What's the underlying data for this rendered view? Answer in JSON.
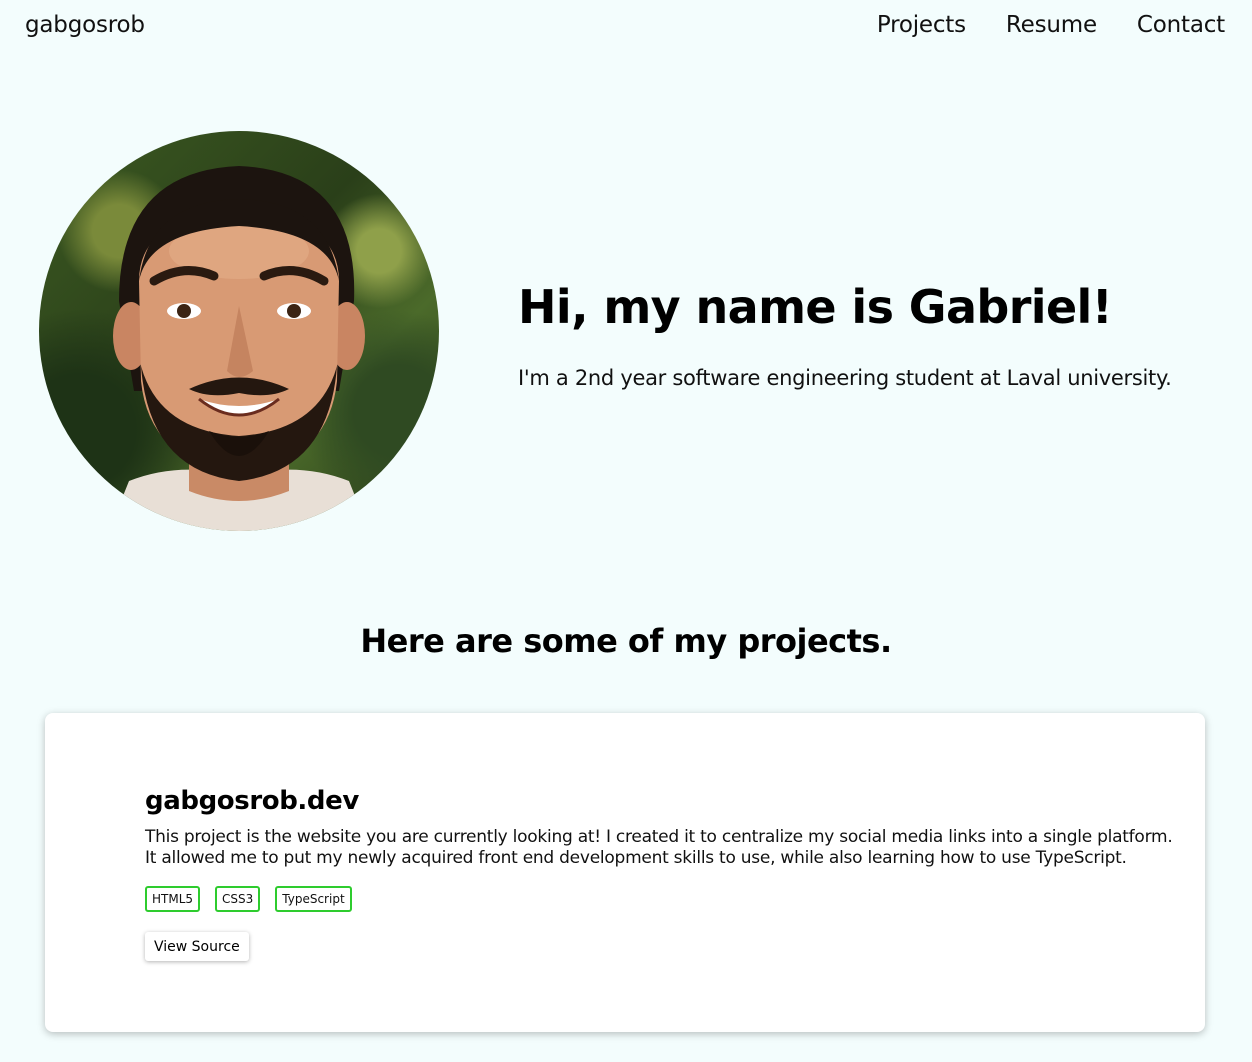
{
  "navbar": {
    "brand": "gabgosrob",
    "links": [
      "Projects",
      "Resume",
      "Contact"
    ]
  },
  "hero": {
    "avatar_icon": "profile-photo",
    "title": "Hi, my name is Gabriel!",
    "subtitle": "I'm a 2nd year software engineering student at Laval university."
  },
  "projects": {
    "heading": "Here are some of my projects.",
    "items": [
      {
        "title": "gabgosrob.dev",
        "description": "This project is the website you are currently looking at! I created it to centralize my social media links into a single platform. It allowed me to put my newly acquired front end development skills to use, while also learning how to use TypeScript.",
        "tags": [
          "HTML5",
          "CSS3",
          "TypeScript"
        ],
        "button_label": "View Source"
      }
    ]
  },
  "colors": {
    "background": "#f3fdfd",
    "tag_border": "#2ecc2e",
    "card_background": "#ffffff"
  }
}
